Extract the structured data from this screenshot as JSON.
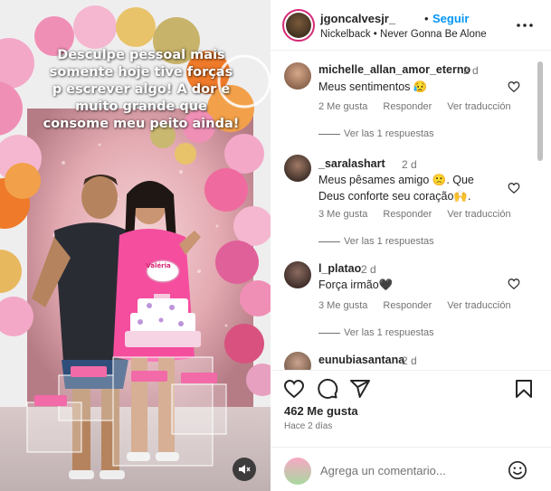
{
  "post": {
    "caption": "Desculpe pessoal mais\nsomente hoje tive forças\np escrever algo!  A dor e\nmuito grande que\nconsome meu peito ainda!",
    "cake_name": "Valéria"
  },
  "header": {
    "username": "jgoncalvesjr_",
    "dot": "•",
    "follow_label": "Seguir",
    "song": "Nickelback • Never Gonna Be Alone"
  },
  "comments": [
    {
      "username": "michelle_allan_amor_eterno",
      "time": "2 d",
      "text": "Meus sentimentos 😥",
      "likes": "2 Me gusta",
      "reply_label": "Responder",
      "translate_label": "Ver traducción",
      "replies_label": "Ver las 1 respuestas"
    },
    {
      "username": "_saralashart",
      "time": "2 d",
      "text": "Meus pêsames amigo 🙁. Que Deus conforte seu coração🙌.",
      "likes": "3 Me gusta",
      "reply_label": "Responder",
      "translate_label": "Ver traducción",
      "replies_label": "Ver las 1 respuestas"
    },
    {
      "username": "l_platao",
      "time": "2 d",
      "text": "Força irmão🖤",
      "likes": "3 Me gusta",
      "reply_label": "Responder",
      "translate_label": "Ver traducción",
      "replies_label": "Ver las 1 respuestas"
    },
    {
      "username": "eunubiasantana",
      "time": "2 d"
    }
  ],
  "footer": {
    "likes": "462 Me gusta",
    "ago": "Hace 2 días",
    "comment_placeholder": "Agrega un comentario..."
  },
  "icons": {
    "like": "heart-icon",
    "comment": "comment-icon",
    "share": "share-icon",
    "save": "bookmark-icon",
    "more": "more-horizontal-icon",
    "mute": "speaker-muted-icon",
    "emoji": "emoji-icon"
  },
  "colors": {
    "follow": "#0095f6",
    "text": "#262626",
    "secondary": "#737373"
  }
}
